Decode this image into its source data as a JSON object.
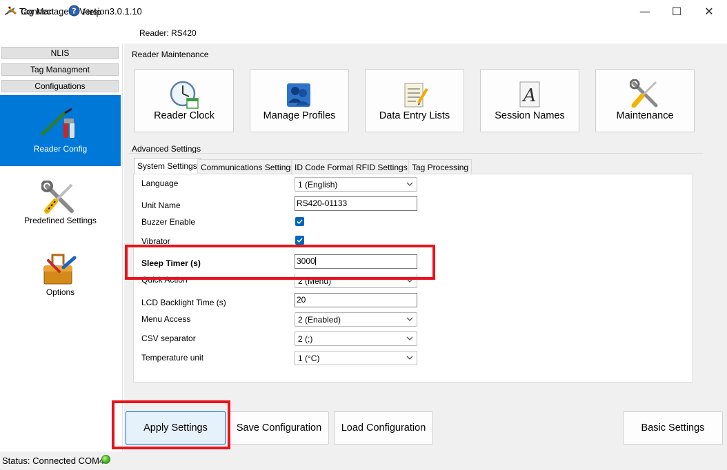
{
  "window": {
    "title": "Tag Manager - Version3.0.1.10",
    "minimize_glyph": "—",
    "maximize_glyph": "☐",
    "close_glyph": "✕"
  },
  "menu": {
    "connect_label": "Connect",
    "help_label": "Help",
    "reader_label": "Reader: RS420"
  },
  "nav": {
    "nlis": "NLIS",
    "tag_management": "Tag Managment",
    "configurations": "Configuations",
    "items": [
      {
        "label": "Reader Config",
        "icon": "tools-icon",
        "selected": true
      },
      {
        "label": "Predefined Settings",
        "icon": "wrench-screwdriver-icon",
        "selected": false
      },
      {
        "label": "Options",
        "icon": "toolbox-icon",
        "selected": false
      }
    ]
  },
  "maintenance": {
    "group_label": "Reader Maintenance",
    "buttons": [
      {
        "label": "Reader Clock",
        "icon": "clock-icon"
      },
      {
        "label": "Manage Profiles",
        "icon": "profiles-icon"
      },
      {
        "label": "Data Entry Lists",
        "icon": "notepad-icon"
      },
      {
        "label": "Session Names",
        "icon": "letter-a-icon"
      },
      {
        "label": "Maintenance",
        "icon": "maintenance-icon"
      }
    ]
  },
  "advanced": {
    "group_label": "Advanced Settings",
    "tabs": [
      "System Settings",
      "Communications Settings",
      "ID Code Format",
      "RFID Settings",
      "Tag Processing"
    ],
    "active_tab": "System Settings",
    "settings": {
      "language": {
        "label": "Language",
        "value": "1 (English)"
      },
      "unit_name": {
        "label": "Unit Name",
        "value": "RS420-01133"
      },
      "buzzer": {
        "label": "Buzzer Enable",
        "checked": true
      },
      "vibrator": {
        "label": "Vibrator",
        "checked": true
      },
      "sleep_timer": {
        "label": "Sleep Timer (s)",
        "value": "3000"
      },
      "quick_action": {
        "label": "Quick Action",
        "value": "2 (Menu)"
      },
      "lcd_backlight": {
        "label": "LCD Backlight Time (s)",
        "value": "20"
      },
      "menu_access": {
        "label": "Menu Access",
        "value": "2 (Enabled)"
      },
      "csv_separator": {
        "label": "CSV separator",
        "value": "2 (;)"
      },
      "temperature_unit": {
        "label": "Temperature unit",
        "value": "1 (°C)"
      }
    }
  },
  "buttons": {
    "apply": "Apply Settings",
    "save": "Save Configuration",
    "load": "Load Configuration",
    "basic": "Basic Settings"
  },
  "status": {
    "text": "Status: Connected COM4",
    "led_color": "#3fb21a"
  },
  "colors": {
    "accent": "#0078d7",
    "highlight": "#e8141c"
  }
}
